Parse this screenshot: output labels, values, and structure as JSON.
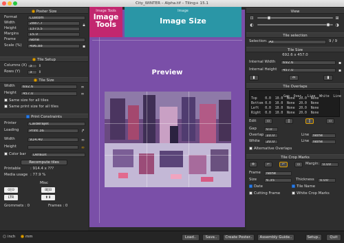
{
  "window": {
    "title": "City_WINTER – Alpha.tif – Tiling+ 15.1"
  },
  "overlays": {
    "tools_small": "Image Tools",
    "tools_big1": "Image",
    "tools_big2": "Tools",
    "size_small": "Image",
    "size_big": "Image Size",
    "preview_label": "Preview"
  },
  "left": {
    "poster_size": {
      "header": "Poster Size",
      "format_label": "Format",
      "format_value": "Custom",
      "width_label": "Width",
      "width_value": "2887.7",
      "height_label": "Height",
      "height_value": "1373.5",
      "margins_label": "Margins",
      "margins_value": "15.0",
      "frame_label": "Frame",
      "frame_value": "None",
      "scale_label": "Scale (%)",
      "scale_value": "496.88"
    },
    "tile_setup": {
      "header": "Tile Setup",
      "columns_label": "Columns (X)",
      "columns_value": "3",
      "rows_label": "Rows (Y)",
      "rows_value": "3"
    },
    "tile_size": {
      "header": "Tile Size",
      "width_label": "Width",
      "width_value": "692.6",
      "height_label": "Height",
      "height_value": "457.0",
      "same_size": "Same size for all tiles",
      "same_print": "Same print size for all tiles"
    },
    "print": {
      "header": "Print Constraints",
      "printer_label": "Printer",
      "printer_value": "CalderaJet",
      "loading_label": "Loading",
      "loading_value": "Print 36",
      "width_label": "Width",
      "width_value": "914.40",
      "height_label": "Height",
      "height_value": "",
      "color_bar_label": "Color bar",
      "color_bar_value": "Default",
      "recompute": "Recompute tiles",
      "printable_label": "Printable",
      "printable_value": ": 914.4 x ???",
      "media_label": "Media usage",
      "media_value": ": 77.9 %"
    },
    "misc": {
      "header": "Misc",
      "grommets_label": "Grommets :",
      "grommets_value": "0",
      "frames_label": "Frames :",
      "frames_value": "0"
    }
  },
  "right": {
    "view": {
      "header": "View"
    },
    "tile_selection": {
      "header": "Tile selection",
      "selection_label": "Selection:",
      "selection_value": "All",
      "count": "9 / 9"
    },
    "tile_size": {
      "header": "Tile Size",
      "dims": "692.6 x 457.0",
      "iw_label": "Internal Width",
      "iw_value": "692.6",
      "ih_label": "Internal Height",
      "ih_value": "457.0"
    },
    "tile_overlaps": {
      "header": "Tile Overlaps",
      "cols": [
        "Gap",
        "Over.",
        "Line",
        "White",
        "Line"
      ],
      "rows": [
        {
          "side": "Top",
          "gap": "0.0",
          "over": "10.0",
          "line": "None",
          "white": "20.0",
          "line2": "None"
        },
        {
          "side": "Bottom",
          "gap": "0.0",
          "over": "10.0",
          "line": "None",
          "white": "20.0",
          "line2": "None"
        },
        {
          "side": "Left",
          "gap": "0.0",
          "over": "10.0",
          "line": "None",
          "white": "20.0",
          "line2": "None"
        },
        {
          "side": "Right",
          "gap": "0.0",
          "over": "10.0",
          "line": "None",
          "white": "20.0",
          "line2": "None"
        }
      ],
      "edit_label": "Edit",
      "gap_label": "Gap",
      "gap_value": "0.0",
      "overlap_label": "Overlap",
      "overlap_value": "10.0",
      "white_label": "White",
      "white_value": "20.0",
      "line_label": "Line",
      "line_value": "None",
      "line2_value": "None",
      "alternative": "Alternative Overlaps"
    },
    "crop_marks": {
      "header": "Tile Crop Marks",
      "margin_label": "Margin:",
      "margin_value": "0.00",
      "frame_label": "Frame",
      "frame_value": "None",
      "size_label": "Size",
      "size_value": "6.35",
      "thickness_label": "Thickness",
      "thickness_value": "0.00",
      "date": "Date",
      "tile_name": "Tile Name",
      "cutting_frame": "Cutting Frame",
      "white_crop": "White Crop Marks"
    }
  },
  "bottom": {
    "unit_inch": "inch",
    "unit_mm": "mm",
    "load": "Load..",
    "save": "Save..",
    "create_poster": "Create Poster..",
    "assembly": "Assembly Guide..",
    "setup": "Setup..",
    "quit": "Quit"
  },
  "colors": {
    "tools_overlay": "#c2276f",
    "size_overlay": "#2a96a6",
    "preview_overlay": "#7a4fa8"
  }
}
